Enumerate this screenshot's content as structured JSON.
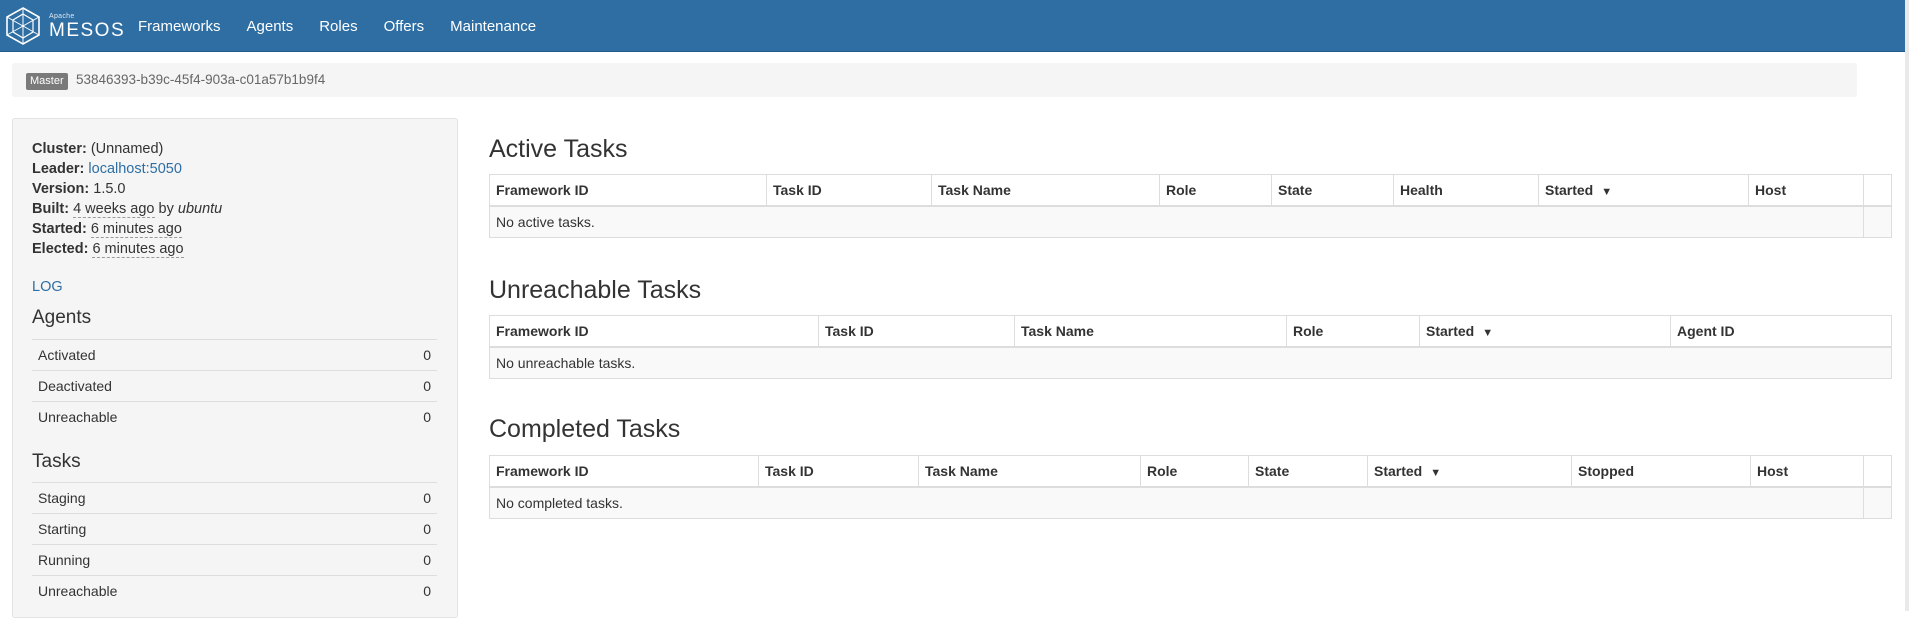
{
  "nav": {
    "brand_small": "Apache",
    "brand": "MESOS",
    "items": [
      "Frameworks",
      "Agents",
      "Roles",
      "Offers",
      "Maintenance"
    ]
  },
  "breadcrumb": {
    "label": "Master",
    "id": "53846393-b39c-45f4-903a-c01a57b1b9f4"
  },
  "cluster": {
    "cluster_label": "Cluster:",
    "cluster_value": "(Unnamed)",
    "leader_label": "Leader:",
    "leader_value": "localhost:5050",
    "version_label": "Version:",
    "version_value": "1.5.0",
    "built_label": "Built:",
    "built_value": "4 weeks ago",
    "built_by": "by",
    "built_user": "ubuntu",
    "started_label": "Started:",
    "started_value": "6 minutes ago",
    "elected_label": "Elected:",
    "elected_value": "6 minutes ago",
    "log_link": "LOG"
  },
  "agents": {
    "title": "Agents",
    "rows": [
      {
        "label": "Activated",
        "value": "0"
      },
      {
        "label": "Deactivated",
        "value": "0"
      },
      {
        "label": "Unreachable",
        "value": "0"
      }
    ]
  },
  "tasks": {
    "title": "Tasks",
    "rows": [
      {
        "label": "Staging",
        "value": "0"
      },
      {
        "label": "Starting",
        "value": "0"
      },
      {
        "label": "Running",
        "value": "0"
      },
      {
        "label": "Unreachable",
        "value": "0"
      }
    ]
  },
  "active_tasks": {
    "title": "Active Tasks",
    "columns": [
      "Framework ID",
      "Task ID",
      "Task Name",
      "Role",
      "State",
      "Health",
      "Started",
      "Host",
      ""
    ],
    "empty": "No active tasks."
  },
  "unreachable_tasks": {
    "title": "Unreachable Tasks",
    "columns": [
      "Framework ID",
      "Task ID",
      "Task Name",
      "Role",
      "Started",
      "Agent ID"
    ],
    "empty": "No unreachable tasks."
  },
  "completed_tasks": {
    "title": "Completed Tasks",
    "columns": [
      "Framework ID",
      "Task ID",
      "Task Name",
      "Role",
      "State",
      "Started",
      "Stopped",
      "Host",
      ""
    ],
    "empty": "No completed tasks."
  },
  "sort_indicator": "▼"
}
